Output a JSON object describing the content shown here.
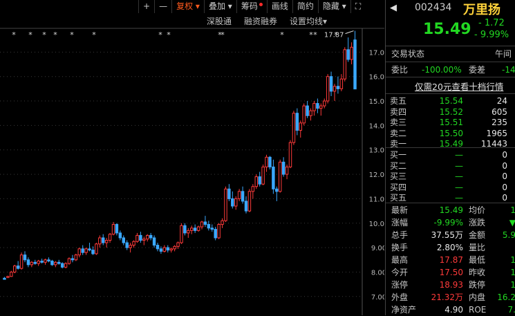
{
  "toolbar": {
    "plus": "+",
    "minus": "—",
    "fuquan": "复权",
    "diejia": "叠加",
    "chouma": "筹码",
    "huaxian": "画线",
    "jianyue": "简约",
    "yincang": "隐藏"
  },
  "subbar": {
    "shengutong": "深股通",
    "rongzi": "融资融券",
    "junxian": "设置均线"
  },
  "chart_data": {
    "type": "candlestick",
    "yticks": [
      "17.00",
      "16.00",
      "15.00",
      "14.00",
      "13.00",
      "12.00",
      "11.00",
      "10.00",
      "9.00",
      "8.00",
      "7.00"
    ],
    "yrange": [
      6.4,
      18.0
    ],
    "max_label": "17.87",
    "candles": [
      [
        7.75,
        7.8,
        7.72,
        7.7
      ],
      [
        7.78,
        7.85,
        7.75,
        7.82
      ],
      [
        7.82,
        8.05,
        7.8,
        8.0
      ],
      [
        8.0,
        8.3,
        7.95,
        8.25
      ],
      [
        8.25,
        8.45,
        8.1,
        8.15
      ],
      [
        8.15,
        8.8,
        8.1,
        8.7
      ],
      [
        8.7,
        8.85,
        8.4,
        8.5
      ],
      [
        8.5,
        8.6,
        8.2,
        8.3
      ],
      [
        8.3,
        8.45,
        8.2,
        8.4
      ],
      [
        8.4,
        8.5,
        8.3,
        8.35
      ],
      [
        8.35,
        8.5,
        8.25,
        8.45
      ],
      [
        8.45,
        8.55,
        8.35,
        8.4
      ],
      [
        8.4,
        8.55,
        8.3,
        8.5
      ],
      [
        8.5,
        8.6,
        8.4,
        8.45
      ],
      [
        8.45,
        8.5,
        8.25,
        8.3
      ],
      [
        8.3,
        8.45,
        8.2,
        8.4
      ],
      [
        8.4,
        8.5,
        8.3,
        8.35
      ],
      [
        8.35,
        8.4,
        8.15,
        8.2
      ],
      [
        8.2,
        8.4,
        8.15,
        8.35
      ],
      [
        8.35,
        8.6,
        8.3,
        8.55
      ],
      [
        8.55,
        8.7,
        8.4,
        8.5
      ],
      [
        8.5,
        8.75,
        8.45,
        8.7
      ],
      [
        8.7,
        9.0,
        8.6,
        8.95
      ],
      [
        8.95,
        9.1,
        8.7,
        8.8
      ],
      [
        8.8,
        9.0,
        8.7,
        8.95
      ],
      [
        8.95,
        9.2,
        8.85,
        8.9
      ],
      [
        8.9,
        9.05,
        8.7,
        8.75
      ],
      [
        8.75,
        9.2,
        8.7,
        9.15
      ],
      [
        9.15,
        9.5,
        9.0,
        9.4
      ],
      [
        9.4,
        9.55,
        9.1,
        9.2
      ],
      [
        9.2,
        9.4,
        9.0,
        9.3
      ],
      [
        9.3,
        9.6,
        9.2,
        9.55
      ],
      [
        9.55,
        10.05,
        9.5,
        9.95
      ],
      [
        9.95,
        10.0,
        9.5,
        9.6
      ],
      [
        9.6,
        9.7,
        9.3,
        9.4
      ],
      [
        9.4,
        9.5,
        9.1,
        9.2
      ],
      [
        9.2,
        9.3,
        8.9,
        9.0
      ],
      [
        9.0,
        9.2,
        8.8,
        9.1
      ],
      [
        9.1,
        9.3,
        9.0,
        9.25
      ],
      [
        9.25,
        9.6,
        9.2,
        9.5
      ],
      [
        9.5,
        9.65,
        9.2,
        9.3
      ],
      [
        9.3,
        9.45,
        9.1,
        9.35
      ],
      [
        9.35,
        9.55,
        9.25,
        9.5
      ],
      [
        9.5,
        9.6,
        9.3,
        9.4
      ],
      [
        9.4,
        9.5,
        9.0,
        9.1
      ],
      [
        9.1,
        9.2,
        8.85,
        8.95
      ],
      [
        8.95,
        9.05,
        8.75,
        8.85
      ],
      [
        8.85,
        9.1,
        8.8,
        9.0
      ],
      [
        9.0,
        9.1,
        8.8,
        8.9
      ],
      [
        8.9,
        9.0,
        8.8,
        8.95
      ],
      [
        8.95,
        9.1,
        8.85,
        9.05
      ],
      [
        9.05,
        9.25,
        8.95,
        9.2
      ],
      [
        9.2,
        10.0,
        9.15,
        9.9
      ],
      [
        9.9,
        10.0,
        9.5,
        9.6
      ],
      [
        9.6,
        9.8,
        9.4,
        9.7
      ],
      [
        9.7,
        9.9,
        9.55,
        9.8
      ],
      [
        9.8,
        9.95,
        9.6,
        9.7
      ],
      [
        9.7,
        9.9,
        9.65,
        9.85
      ],
      [
        9.85,
        10.1,
        9.75,
        10.05
      ],
      [
        10.05,
        10.3,
        9.85,
        9.95
      ],
      [
        9.95,
        10.1,
        9.7,
        9.8
      ],
      [
        9.8,
        9.95,
        9.65,
        9.75
      ],
      [
        9.75,
        9.85,
        9.3,
        9.4
      ],
      [
        9.4,
        10.0,
        9.35,
        9.95
      ],
      [
        9.95,
        10.2,
        9.8,
        10.1
      ],
      [
        10.1,
        11.5,
        10.05,
        11.4
      ],
      [
        11.4,
        11.6,
        10.9,
        11.0
      ],
      [
        11.0,
        11.3,
        10.6,
        10.7
      ],
      [
        10.7,
        11.1,
        10.55,
        11.0
      ],
      [
        11.0,
        11.4,
        10.9,
        11.3
      ],
      [
        11.3,
        11.5,
        10.8,
        10.9
      ],
      [
        10.9,
        11.1,
        10.4,
        10.5
      ],
      [
        10.5,
        11.4,
        10.45,
        11.3
      ],
      [
        11.3,
        11.6,
        11.0,
        11.5
      ],
      [
        11.5,
        12.0,
        11.4,
        11.9
      ],
      [
        11.9,
        12.1,
        11.5,
        11.6
      ],
      [
        11.6,
        12.4,
        11.55,
        12.3
      ],
      [
        12.3,
        12.8,
        12.1,
        12.7
      ],
      [
        12.7,
        12.75,
        12.2,
        12.3
      ],
      [
        12.3,
        12.6,
        11.2,
        11.4
      ],
      [
        11.4,
        11.5,
        10.9,
        11.3
      ],
      [
        11.3,
        12.6,
        11.25,
        12.5
      ],
      [
        12.5,
        12.7,
        11.9,
        12.0
      ],
      [
        12.0,
        12.4,
        11.8,
        12.3
      ],
      [
        12.3,
        13.4,
        12.25,
        13.3
      ],
      [
        13.3,
        14.6,
        13.2,
        14.5
      ],
      [
        14.5,
        14.7,
        13.6,
        13.8
      ],
      [
        13.8,
        14.2,
        13.5,
        14.1
      ],
      [
        14.1,
        14.9,
        14.0,
        14.8
      ],
      [
        14.8,
        15.0,
        14.3,
        14.4
      ],
      [
        14.4,
        14.7,
        14.2,
        14.6
      ],
      [
        14.6,
        15.0,
        14.4,
        14.9
      ],
      [
        14.9,
        15.1,
        14.5,
        14.7
      ],
      [
        14.7,
        14.9,
        14.4,
        14.8
      ],
      [
        14.8,
        15.1,
        14.7,
        15.0
      ],
      [
        15.0,
        16.1,
        14.9,
        16.0
      ],
      [
        16.0,
        16.2,
        15.2,
        15.4
      ],
      [
        15.4,
        15.7,
        15.0,
        15.6
      ],
      [
        15.6,
        16.0,
        15.3,
        15.5
      ],
      [
        15.5,
        16.1,
        15.4,
        15.9
      ],
      [
        15.9,
        17.2,
        15.8,
        17.1
      ],
      [
        17.1,
        17.6,
        16.6,
        16.7
      ],
      [
        16.7,
        17.4,
        16.5,
        17.2
      ],
      [
        17.5,
        17.87,
        15.49,
        15.49
      ]
    ]
  },
  "panel": {
    "code": "002434",
    "name": "万里扬",
    "price": "15.49",
    "change": "- 1.72",
    "change_pct": "- 9.99%",
    "jiaoyi_label": "交易状态",
    "jiaoyi_val": "午间",
    "weibi_label": "委比",
    "weibi_val": "-100.00%",
    "weicha_label": "委差",
    "weicha_val": "-14",
    "link": "仅需20元查看十档行情",
    "asks": [
      {
        "label": "卖五",
        "price": "15.54",
        "vol": "24"
      },
      {
        "label": "卖四",
        "price": "15.52",
        "vol": "605"
      },
      {
        "label": "卖三",
        "price": "15.51",
        "vol": "235"
      },
      {
        "label": "卖二",
        "price": "15.50",
        "vol": "1965"
      },
      {
        "label": "卖一",
        "price": "15.49",
        "vol": "11443"
      }
    ],
    "bids": [
      {
        "label": "买一",
        "price": "—",
        "vol": "0"
      },
      {
        "label": "买二",
        "price": "—",
        "vol": "0"
      },
      {
        "label": "买三",
        "price": "—",
        "vol": "0"
      },
      {
        "label": "买四",
        "price": "—",
        "vol": "0"
      },
      {
        "label": "买五",
        "price": "—",
        "vol": "0"
      }
    ],
    "stats": [
      {
        "l1": "最新",
        "v1": "15.49",
        "c1": "green",
        "l2": "均价",
        "v2": "1"
      },
      {
        "l1": "涨幅",
        "v1": "-9.99%",
        "c1": "green",
        "l2": "涨跌",
        "v2": "▼"
      },
      {
        "l1": "总手",
        "v1": "37.55万",
        "c1": "white",
        "l2": "金额",
        "v2": "5.9"
      },
      {
        "l1": "换手",
        "v1": "2.80%",
        "c1": "white",
        "l2": "量比",
        "v2": ""
      },
      {
        "l1": "最高",
        "v1": "17.87",
        "c1": "red",
        "l2": "最低",
        "v2": "1"
      },
      {
        "l1": "今开",
        "v1": "17.50",
        "c1": "red",
        "l2": "昨收",
        "v2": "1"
      },
      {
        "l1": "涨停",
        "v1": "18.93",
        "c1": "red",
        "l2": "跌停",
        "v2": "1"
      },
      {
        "l1": "外盘",
        "v1": "21.32万",
        "c1": "red",
        "l2": "内盘",
        "v2": "16.2"
      },
      {
        "l1": "净资产",
        "v1": "4.90",
        "c1": "white",
        "l2": "ROE",
        "v2": "7."
      }
    ]
  }
}
